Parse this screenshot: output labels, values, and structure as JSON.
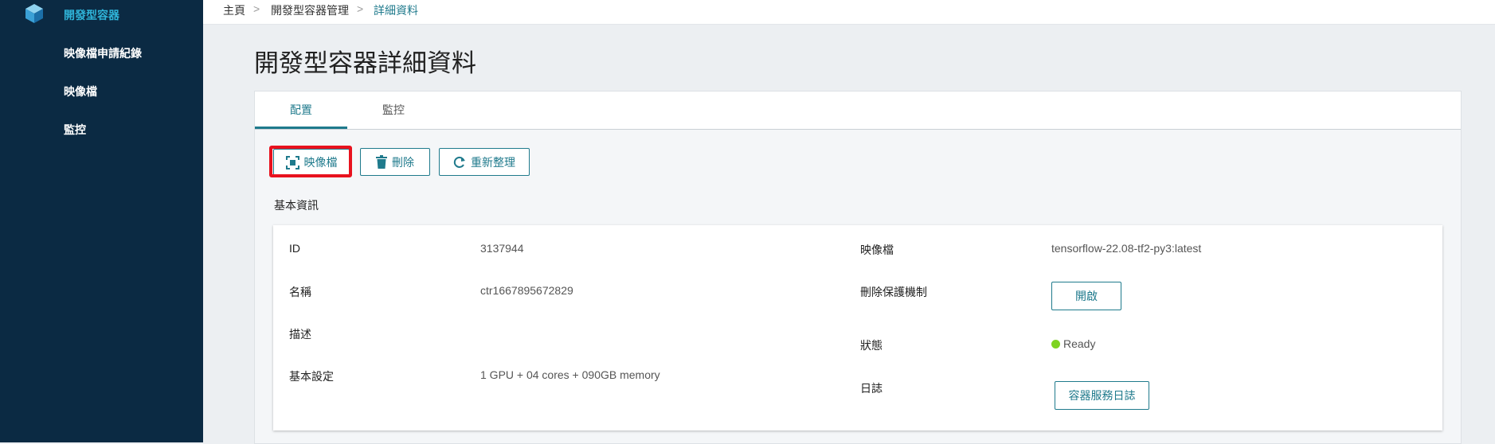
{
  "sidebar": {
    "logo_icon": "cube-icon",
    "items": [
      {
        "label": "開發型容器",
        "active": true
      },
      {
        "label": "映像檔申請紀錄",
        "active": false
      },
      {
        "label": "映像檔",
        "active": false
      },
      {
        "label": "監控",
        "active": false
      }
    ]
  },
  "breadcrumb": {
    "items": [
      "主頁",
      "開發型容器管理",
      "詳細資料"
    ],
    "separator": ">"
  },
  "page": {
    "title": "開發型容器詳細資料"
  },
  "tabs": [
    {
      "label": "配置",
      "active": true
    },
    {
      "label": "監控",
      "active": false
    }
  ],
  "actions": {
    "image": {
      "label": "映像檔",
      "icon": "snapshot-icon"
    },
    "delete": {
      "label": "刪除",
      "icon": "trash-icon"
    },
    "refresh": {
      "label": "重新整理",
      "icon": "refresh-icon"
    }
  },
  "basic_info": {
    "section_title": "基本資訊",
    "id": {
      "label": "ID",
      "value": "3137944"
    },
    "name": {
      "label": "名稱",
      "value": "ctr1667895672829"
    },
    "description": {
      "label": "描述",
      "value": ""
    },
    "settings": {
      "label": "基本設定",
      "value": "1 GPU + 04 cores + 090GB memory"
    },
    "image": {
      "label": "映像檔",
      "value": "tensorflow-22.08-tf2-py3:latest"
    },
    "delete_protection": {
      "label": "刪除保護機制",
      "button": "開啟"
    },
    "status": {
      "label": "狀態",
      "value": "Ready"
    },
    "log": {
      "label": "日誌",
      "button": "容器服務日誌"
    }
  },
  "colors": {
    "sidebar_bg": "#0b2a43",
    "accent": "#1f7a8c",
    "active_nav": "#2fb4d9",
    "highlight": "#e8121e",
    "status_ready": "#7ed321"
  }
}
